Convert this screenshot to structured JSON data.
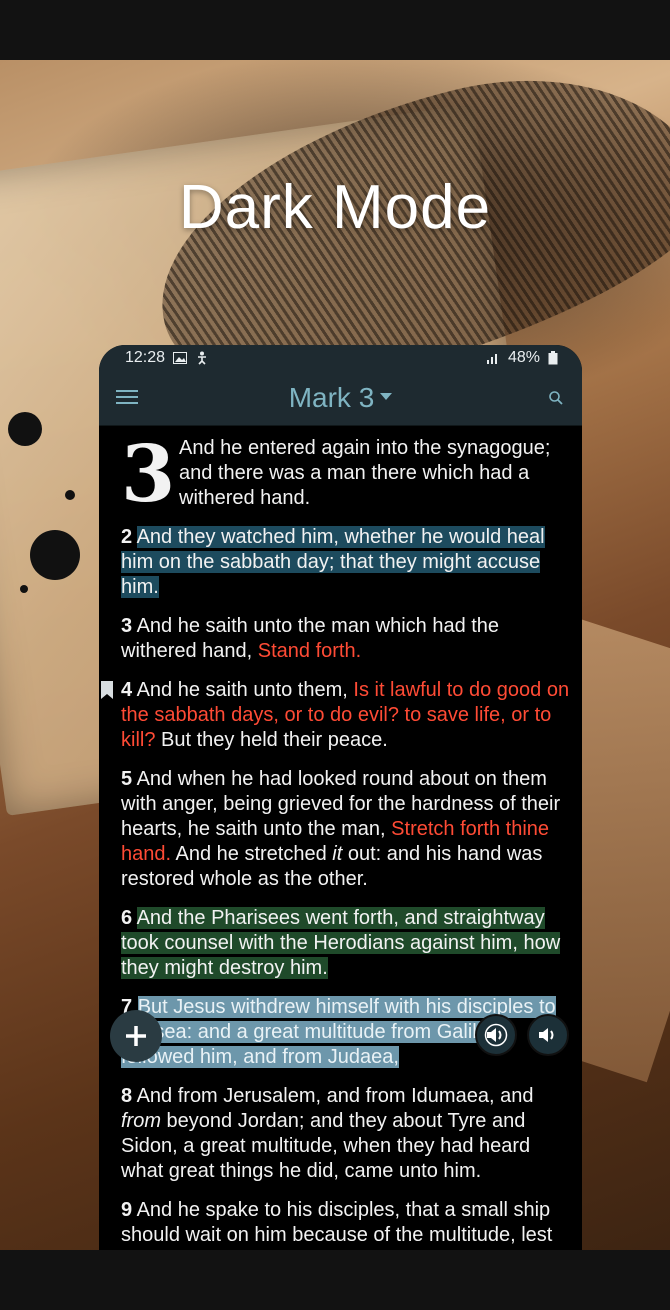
{
  "promo": {
    "title": "Dark Mode"
  },
  "status": {
    "time": "12:28",
    "battery": "48%"
  },
  "appbar": {
    "title": "Mark 3"
  },
  "colors": {
    "appbar": "#1e2a30",
    "accent": "#7fb4c2",
    "words_of_jesus": "#ff4b35",
    "highlight_blue": "#1d4b5e",
    "highlight_green": "#1f4a2a",
    "selection": "#6d97ab"
  },
  "chapter": {
    "dropcap": "3",
    "verse1": "And he entered again into the synagogue; and there was a man there which had a withered hand.",
    "v2": {
      "num": "2",
      "text": "And they watched him, whether he would heal him on the sabbath day; that they might accuse him."
    },
    "v3": {
      "num": "3",
      "a": "And he saith unto the man which had the withered hand, ",
      "red": "Stand forth."
    },
    "v4": {
      "num": "4",
      "a": "And he saith unto them, ",
      "red": "Is it lawful to do good on the sabbath days, or to do evil? to save life, or to kill?",
      "b": " But they held their peace."
    },
    "v5": {
      "num": "5",
      "a": "And when he had looked round about on them with anger, being grieved for the hardness of their hearts, he saith unto the man, ",
      "red": "Stretch forth thine hand.",
      "b": " And he stretched ",
      "it": "it",
      "c": " out: and his hand was restored whole as the other."
    },
    "v6": {
      "num": "6",
      "text": "And the Pharisees went forth, and straightway took counsel with the Herodians against him, how they might destroy him."
    },
    "v7": {
      "num": "7",
      "text": "But Jesus withdrew himself with his disciples to the sea: and a great multitude from Galilee followed him, and from Judaea,"
    },
    "v8": {
      "num": "8",
      "a": "And from Jerusalem, and from Idumaea, and ",
      "it": "from",
      "b": " beyond Jordan; and they about Tyre and Sidon, a great multitude, when they had heard what great things he did, came unto him."
    },
    "v9": {
      "num": "9",
      "text": "And he spake to his disciples, that a small ship should wait on him because of the multitude, lest"
    }
  }
}
